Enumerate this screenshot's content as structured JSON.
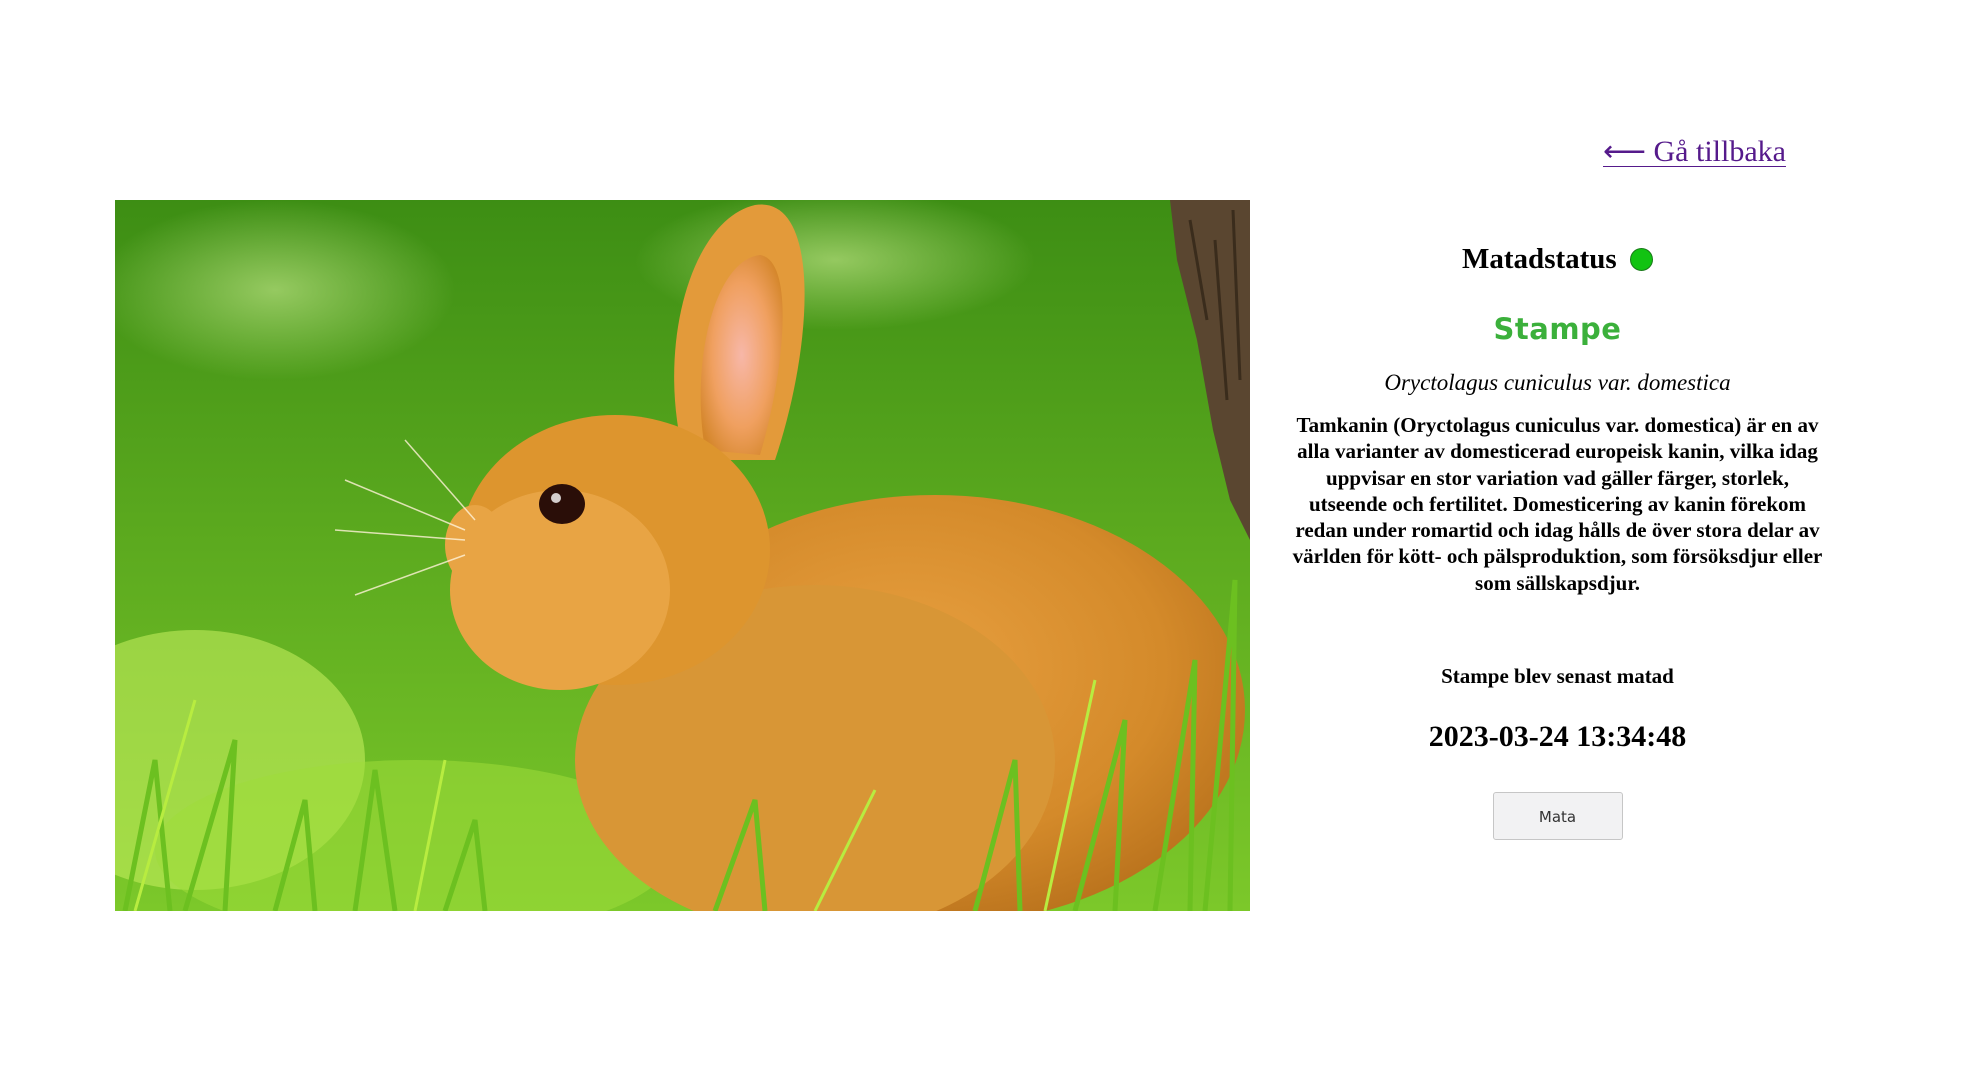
{
  "navigation": {
    "back_label": "⟵ Gå tillbaka"
  },
  "pet": {
    "status_label": "Matadstatus",
    "status_color": "#12c312",
    "name": "Stampe",
    "name_color": "#3bb03b",
    "latin_name": "Oryctolagus cuniculus var. domestica",
    "description": "Tamkanin (Oryctolagus cuniculus var. domestica) är en av alla varianter av domesticerad europeisk kanin, vilka idag uppvisar en stor variation vad gäller färger, storlek, utseende och fertilitet. Domesticering av kanin förekom redan under romartid och idag hålls de över stora delar av världen för kött- och pälsproduktion, som försöksdjur eller som sällskapsdjur.",
    "last_fed_label": "Stampe blev senast matad",
    "last_fed_time": "2023-03-24 13:34:48"
  },
  "actions": {
    "feed_label": "Mata"
  }
}
